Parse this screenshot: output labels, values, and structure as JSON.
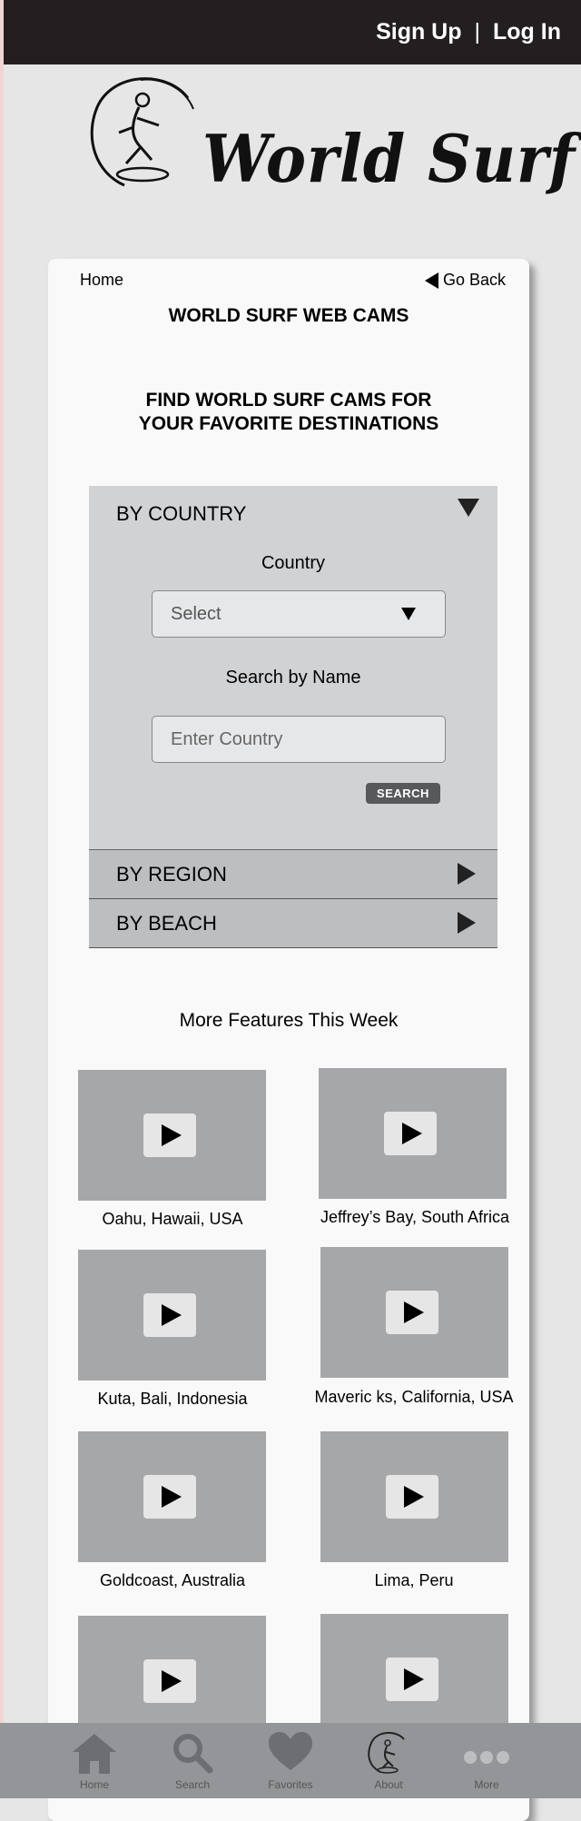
{
  "header": {
    "signup": "Sign Up",
    "separator": "|",
    "login": "Log In"
  },
  "logo": {
    "text": "World Surf"
  },
  "nav": {
    "home": "Home",
    "go_back": "Go Back"
  },
  "page_title": "WORLD SURF WEB CAMS",
  "headline": {
    "line1": "FIND WORLD SURF CAMS FOR",
    "line2": "YOUR FAVORITE DESTINATIONS"
  },
  "accordion": {
    "country": {
      "title": "BY COUNTRY",
      "country_label": "Country",
      "select_value": "Select",
      "search_label": "Search by Name",
      "input_placeholder": "Enter Country",
      "search_button": "SEARCH"
    },
    "region": "BY REGION",
    "beach": "BY BEACH"
  },
  "features": {
    "title": "More Features This Week",
    "items": [
      "Oahu, Hawaii, USA",
      "Jeffrey’s Bay, South Africa",
      "Kuta, Bali, Indonesia",
      "Maveric ks, California, USA",
      "Goldcoast, Australia",
      "Lima, Peru"
    ]
  },
  "tabbar": {
    "home": "Home",
    "search": "Search",
    "favorites": "Favorites",
    "about": "About",
    "more": "More"
  }
}
